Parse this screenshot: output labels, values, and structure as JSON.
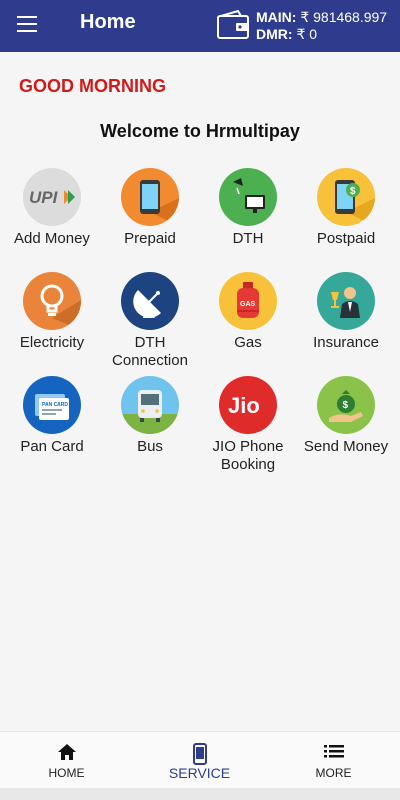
{
  "header": {
    "title": "Home",
    "main_label": "MAIN:",
    "main_value": "₹ 981468.997",
    "dmr_label": "DMR:",
    "dmr_value": "₹ 0"
  },
  "greeting": "GOOD MORNING",
  "welcome": "Welcome to Hrmultipay",
  "services": [
    {
      "label": "Add Money",
      "icon": "upi-icon"
    },
    {
      "label": "Prepaid",
      "icon": "mobile-phone-icon"
    },
    {
      "label": "DTH",
      "icon": "dth-tv-icon"
    },
    {
      "label": "Postpaid",
      "icon": "postpaid-phone-icon"
    },
    {
      "label": "Electricity",
      "icon": "bulb-icon"
    },
    {
      "label": "DTH Connection",
      "icon": "satellite-dish-icon"
    },
    {
      "label": "Gas",
      "icon": "gas-cylinder-icon"
    },
    {
      "label": "Insurance",
      "icon": "insurance-person-icon"
    },
    {
      "label": "Pan Card",
      "icon": "pan-card-icon"
    },
    {
      "label": "Bus",
      "icon": "bus-icon"
    },
    {
      "label": "JIO Phone Booking",
      "icon": "jio-icon"
    },
    {
      "label": "Send Money",
      "icon": "money-bag-icon"
    }
  ],
  "nav": {
    "home": "HOME",
    "service": "SERVICE",
    "more": "MORE"
  },
  "colors": {
    "appbar": "#2f3c8e",
    "greeting": "#d11a1a",
    "upi_bg": "#dcdcdc",
    "orange": "#f28b30",
    "green": "#4caf50",
    "yellow": "#f7c23a",
    "navy": "#1d4480",
    "teal": "#35a89a",
    "sky": "#6fc3ec",
    "red": "#e02b2b",
    "light_green": "#8bc34a"
  }
}
